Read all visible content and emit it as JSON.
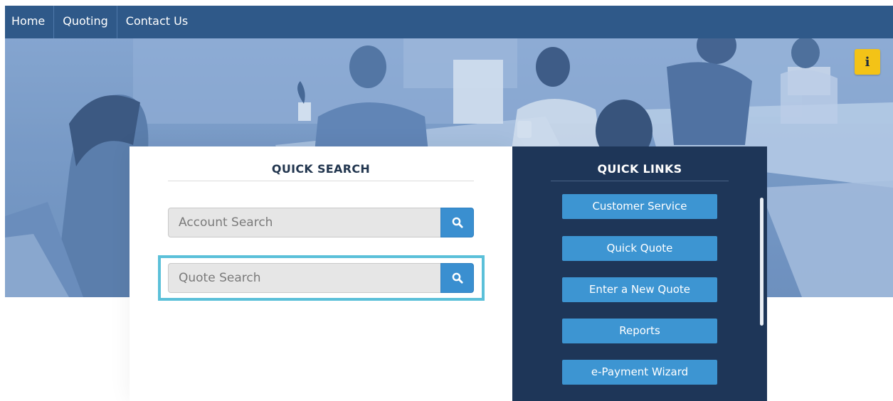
{
  "nav": {
    "items": [
      {
        "label": "Home"
      },
      {
        "label": "Quoting"
      },
      {
        "label": "Contact Us"
      }
    ]
  },
  "info_button": {
    "label": "i"
  },
  "quick_search": {
    "title": "QUICK SEARCH",
    "account_search": {
      "value": "",
      "placeholder": "Account Search"
    },
    "quote_search": {
      "value": "",
      "placeholder": "Quote Search"
    }
  },
  "quick_links": {
    "title": "QUICK LINKS",
    "items": [
      {
        "label": "Customer Service"
      },
      {
        "label": "Quick Quote"
      },
      {
        "label": "Enter a New Quote"
      },
      {
        "label": "Reports"
      },
      {
        "label": "e-Payment Wizard"
      }
    ]
  },
  "colors": {
    "nav_bg": "#2f5989",
    "hero_tint": "#7a9bc7",
    "accent_button": "#3d95d2",
    "links_panel_bg": "#1e3658",
    "focus_ring": "#5bc0d9",
    "info_yellow": "#f3c317"
  },
  "icons": {
    "search": "search-icon",
    "info": "info-icon"
  }
}
